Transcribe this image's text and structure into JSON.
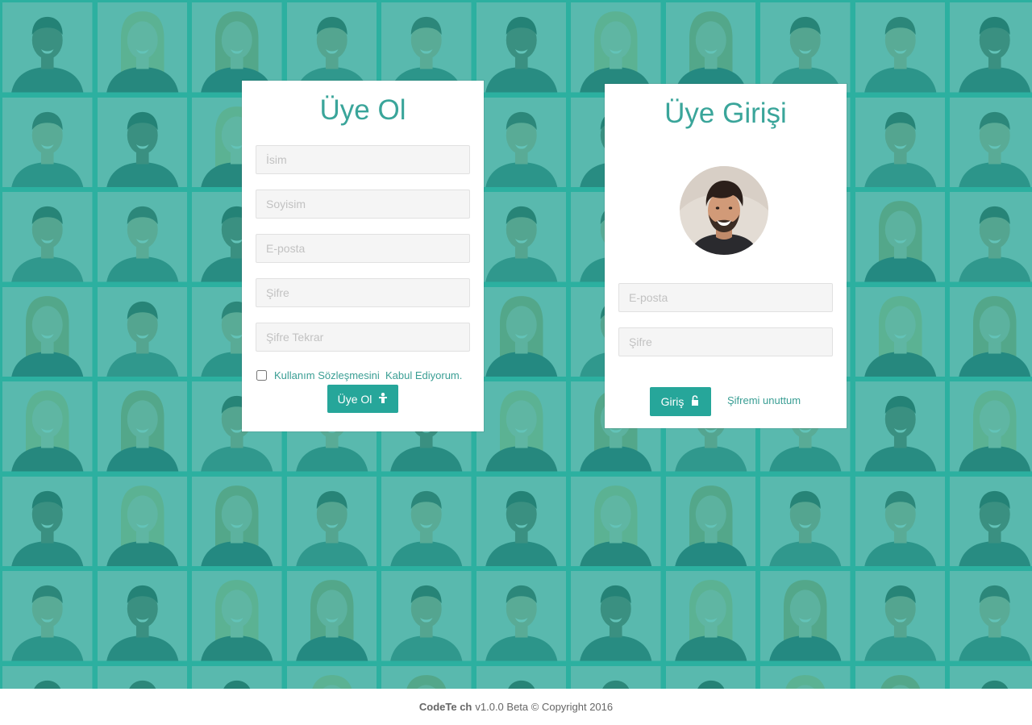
{
  "register": {
    "title": "Üye Ol",
    "placeholders": {
      "first_name": "İsim",
      "last_name": "Soyisim",
      "email": "E-posta",
      "password": "Şifre",
      "password_repeat": "Şifre Tekrar"
    },
    "terms_label": "Kullanım Sözleşmesini  Kabul Ediyorum.",
    "terms_checked": false,
    "submit_label": "Üye Ol",
    "submit_icon": "user-icon"
  },
  "login": {
    "title": "Üye Girişi",
    "avatar": "user-avatar-photo",
    "placeholders": {
      "email": "E-posta",
      "password": "Şifre"
    },
    "submit_label": "Giriş",
    "submit_icon": "unlock-icon",
    "forgot_label": "Şifremi unuttum"
  },
  "footer": {
    "brand": "CodeTe ch",
    "text": "v1.0.0 Beta © Copyright 2016"
  },
  "colors": {
    "accent": "#26a69a",
    "title": "#3aa59a",
    "overlay": "#3bb9a9"
  }
}
